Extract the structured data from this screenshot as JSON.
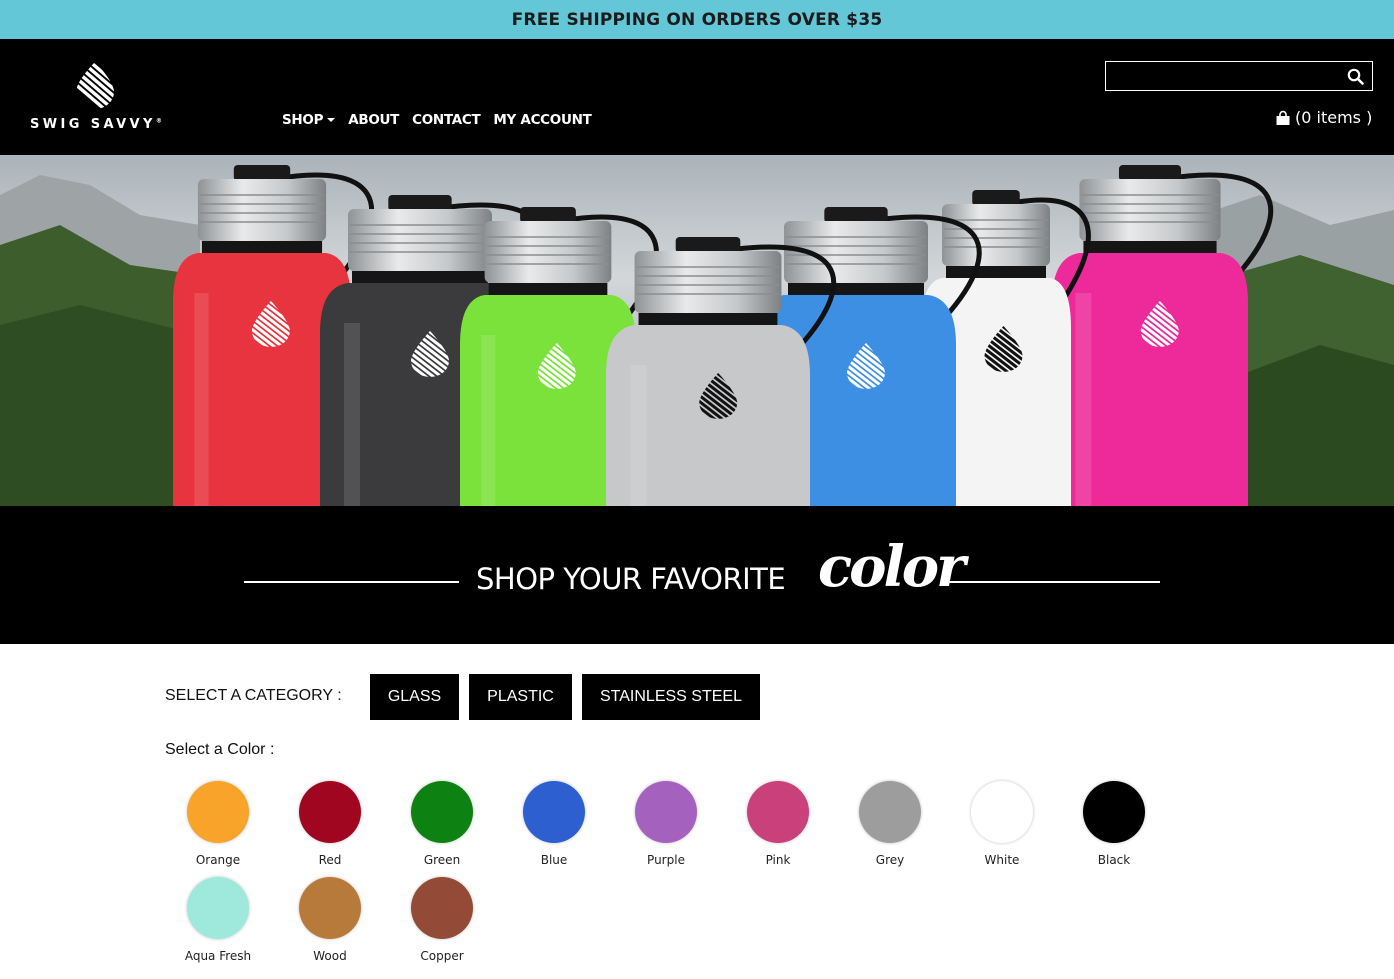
{
  "promo": {
    "text": "FREE SHIPPING ON ORDERS OVER $35"
  },
  "header": {
    "logo_text": "SWIG SAVVY",
    "logo_mark": "®",
    "nav": [
      {
        "label": "SHOP",
        "has_dropdown": true
      },
      {
        "label": "ABOUT"
      },
      {
        "label": "CONTACT"
      },
      {
        "label": "MY ACCOUNT"
      }
    ],
    "search": {
      "placeholder": "",
      "icon": "search-icon"
    },
    "cart": {
      "label": "(0 items )",
      "icon": "shopping-bag-icon"
    }
  },
  "hero": {
    "bottles": [
      {
        "color": "#e8343f"
      },
      {
        "color": "#3b3b3d"
      },
      {
        "color": "#7be23c"
      },
      {
        "color": "#c7c8ca"
      },
      {
        "color": "#3d8fe3"
      },
      {
        "color": "#f4f4f4"
      },
      {
        "color": "#ee2a9a"
      }
    ]
  },
  "banner": {
    "text": "SHOP YOUR FAVORITE",
    "script": "color"
  },
  "filters": {
    "category_label": "SELECT A CATEGORY :",
    "categories": [
      "GLASS",
      "PLASTIC",
      "STAINLESS STEEL"
    ],
    "color_label": "Select a Color :",
    "colors": [
      {
        "name": "Orange",
        "hex": "#f8a42b"
      },
      {
        "name": "Red",
        "hex": "#a0061f"
      },
      {
        "name": "Green",
        "hex": "#0d8212"
      },
      {
        "name": "Blue",
        "hex": "#2d5fd0"
      },
      {
        "name": "Purple",
        "hex": "#a461bd"
      },
      {
        "name": "Pink",
        "hex": "#c9407a"
      },
      {
        "name": "Grey",
        "hex": "#9c9d9c"
      },
      {
        "name": "White",
        "hex": "#ffffff"
      },
      {
        "name": "Black",
        "hex": "#000000"
      },
      {
        "name": "Aqua Fresh",
        "hex": "#9ee9dc"
      },
      {
        "name": "Wood",
        "hex": "#b87a3a"
      },
      {
        "name": "Copper",
        "hex": "#934b38"
      }
    ]
  }
}
